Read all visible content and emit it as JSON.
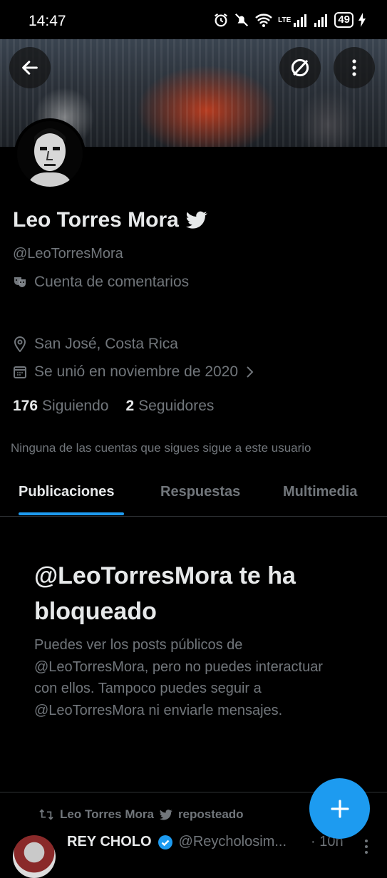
{
  "status_bar": {
    "time": "14:47",
    "network_label": "LTE",
    "battery": "49",
    "icons": [
      "alarm-icon",
      "mute-icon",
      "wifi-icon",
      "signal-icon",
      "battery-icon",
      "charging-icon"
    ]
  },
  "header": {
    "back_icon": "back-arrow-icon",
    "grok_icon": "slash-circle-icon",
    "more_icon": "more-vertical-icon"
  },
  "profile": {
    "name": "Leo Torres Mora",
    "handle": "@LeoTorresMora",
    "label": "Cuenta de comentarios",
    "location": "San José, Costa Rica",
    "joined": "Se unió en noviembre de 2020",
    "following_count": "176",
    "following_label": "Siguiendo",
    "followers_count": "2",
    "followers_label": "Seguidores",
    "followers_you_know": "Ninguna de las cuentas que sigues sigue a este usuario"
  },
  "tabs": [
    {
      "label": "Publicaciones",
      "active": true
    },
    {
      "label": "Respuestas",
      "active": false
    },
    {
      "label": "Multimedia",
      "active": false
    }
  ],
  "blocked": {
    "title": "@LeoTorresMora te ha bloqueado",
    "body": "Puedes ver los posts públicos de @LeoTorresMora, pero no puedes interactuar con ellos. Tampoco puedes seguir a @LeoTorresMora ni enviarle mensajes."
  },
  "tweet": {
    "repost_name": "Leo Torres Mora",
    "repost_label": "reposteado",
    "author_name": "REY CHOLO",
    "author_handle": "@Reycholosim...",
    "time": "· 10h"
  },
  "colors": {
    "accent": "#1d9bf0",
    "background": "#000000",
    "text_primary": "#e7e9ea",
    "text_secondary": "#71767b",
    "divider": "#2f3336"
  }
}
